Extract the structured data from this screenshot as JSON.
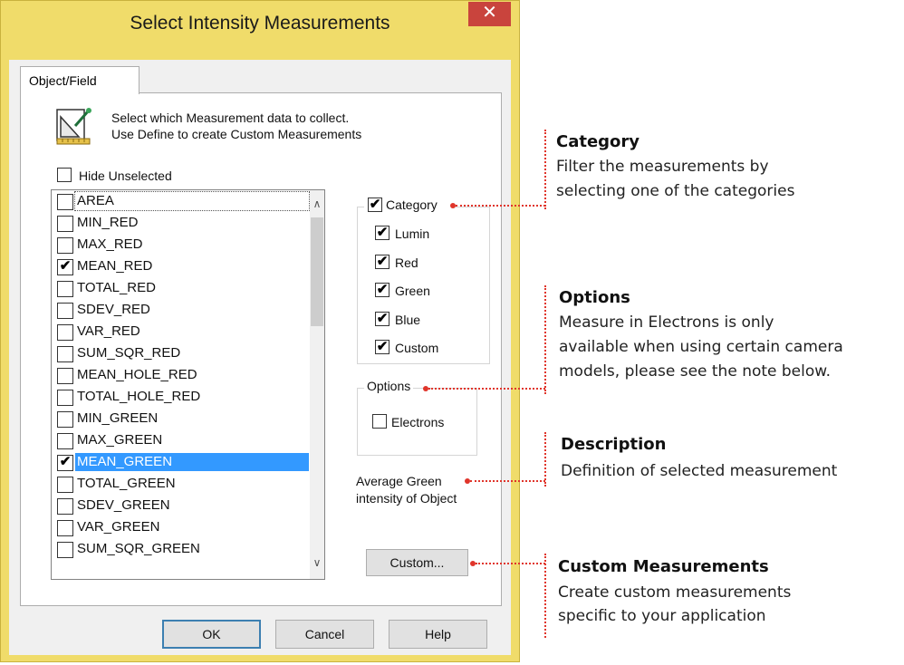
{
  "window": {
    "title": "Select Intensity Measurements",
    "close_glyph": "✕"
  },
  "tab": {
    "label": "Object/Field"
  },
  "hint": {
    "line1": "Select which Measurement data to collect.",
    "line2": "Use Define to create Custom Measurements"
  },
  "hide_unselected": {
    "label": "Hide Unselected",
    "checked": false
  },
  "measurements": [
    {
      "label": "AREA",
      "checked": false
    },
    {
      "label": "MIN_RED",
      "checked": false
    },
    {
      "label": "MAX_RED",
      "checked": false
    },
    {
      "label": "MEAN_RED",
      "checked": true
    },
    {
      "label": "TOTAL_RED",
      "checked": false
    },
    {
      "label": "SDEV_RED",
      "checked": false
    },
    {
      "label": "VAR_RED",
      "checked": false
    },
    {
      "label": "SUM_SQR_RED",
      "checked": false
    },
    {
      "label": "MEAN_HOLE_RED",
      "checked": false
    },
    {
      "label": "TOTAL_HOLE_RED",
      "checked": false
    },
    {
      "label": "MIN_GREEN",
      "checked": false
    },
    {
      "label": "MAX_GREEN",
      "checked": false
    },
    {
      "label": "MEAN_GREEN",
      "checked": true
    },
    {
      "label": "TOTAL_GREEN",
      "checked": false
    },
    {
      "label": "SDEV_GREEN",
      "checked": false
    },
    {
      "label": "VAR_GREEN",
      "checked": false
    },
    {
      "label": "SUM_SQR_GREEN",
      "checked": false
    }
  ],
  "category": {
    "label": "Category",
    "checked": true,
    "items": [
      {
        "label": "Lumin",
        "checked": true
      },
      {
        "label": "Red",
        "checked": true
      },
      {
        "label": "Green",
        "checked": true
      },
      {
        "label": "Blue",
        "checked": true
      },
      {
        "label": "Custom",
        "checked": true
      }
    ]
  },
  "options": {
    "label": "Options",
    "electrons": {
      "label": "Electrons",
      "checked": false
    }
  },
  "description": {
    "line1": "Average Green",
    "line2": "intensity of Object"
  },
  "buttons": {
    "custom": "Custom...",
    "ok": "OK",
    "cancel": "Cancel",
    "help": "Help"
  },
  "check_glyph": "✔",
  "scroll": {
    "up_glyph": "∧",
    "down_glyph": "∨"
  },
  "annotations": {
    "category": {
      "title": "Category",
      "line1": "Filter the measurements by",
      "line2": "selecting one of the categories"
    },
    "options": {
      "title": "Options",
      "line1": "Measure in Electrons is only",
      "line2": "available when using certain camera",
      "line3": "models, please see the note below."
    },
    "description": {
      "title": "Description",
      "line1": "Definition of selected measurement"
    },
    "custom": {
      "title": "Custom Measurements",
      "line1": "Create custom measurements",
      "line2": "specific to your application"
    }
  },
  "colors": {
    "title_bar": "#f0dc6a",
    "close_button": "#c9443d",
    "selection": "#3399ff",
    "annotation": "#e0352b"
  }
}
